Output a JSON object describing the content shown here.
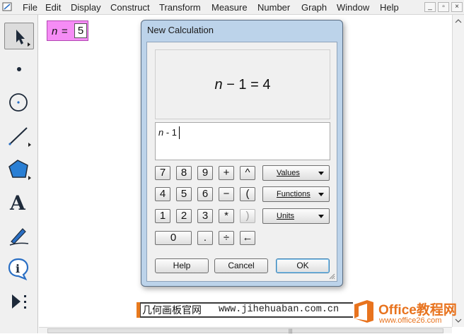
{
  "menubar": {
    "items": [
      "File",
      "Edit",
      "Display",
      "Construct",
      "Transform",
      "Measure",
      "Number",
      "Graph",
      "Window",
      "Help"
    ],
    "window_controls": [
      "_",
      "▫",
      "×"
    ]
  },
  "toolbar": {
    "tools": [
      {
        "name": "arrow-tool",
        "icon": "arrow-select-icon",
        "active": true
      },
      {
        "name": "point-tool",
        "icon": "point-icon"
      },
      {
        "name": "compass-tool",
        "icon": "circle-icon"
      },
      {
        "name": "straightedge-tool",
        "icon": "segment-icon"
      },
      {
        "name": "polygon-tool",
        "icon": "polygon-icon"
      },
      {
        "name": "text-tool",
        "icon": "text-a-icon",
        "glyph": "A"
      },
      {
        "name": "marker-tool",
        "icon": "pen-icon"
      },
      {
        "name": "information-tool",
        "icon": "info-icon",
        "glyph": "i"
      },
      {
        "name": "custom-tool",
        "icon": "custom-tools-icon"
      }
    ]
  },
  "canvas": {
    "parameter": {
      "name": "n",
      "equals": "=",
      "value": "5"
    }
  },
  "dialog": {
    "title": "New Calculation",
    "preview": {
      "var": "n",
      "rest": " − 1 = 4"
    },
    "expression": {
      "var": "n",
      "rest": " - 1"
    },
    "keypad": [
      [
        "7",
        "8",
        "9",
        "+",
        "^"
      ],
      [
        "4",
        "5",
        "6",
        "−",
        "("
      ],
      [
        "1",
        "2",
        "3",
        "*",
        ")"
      ],
      [
        "0",
        ".",
        "÷",
        "←"
      ]
    ],
    "dropdowns": [
      "Values",
      "Functions",
      "Units"
    ],
    "buttons": {
      "help": "Help",
      "cancel": "Cancel",
      "ok": "OK"
    }
  },
  "watermark": {
    "site_cn": "几何画板官网",
    "site_url": "www.jihehuaban.com.cn",
    "logo_title": "Office教程网",
    "logo_url": "www.office26.com"
  },
  "colors": {
    "parameter_fill": "#f58cf5",
    "dialog_frame": "#bcd3ea",
    "logo_orange": "#e8731e",
    "default_button": "#3c7fb1"
  }
}
